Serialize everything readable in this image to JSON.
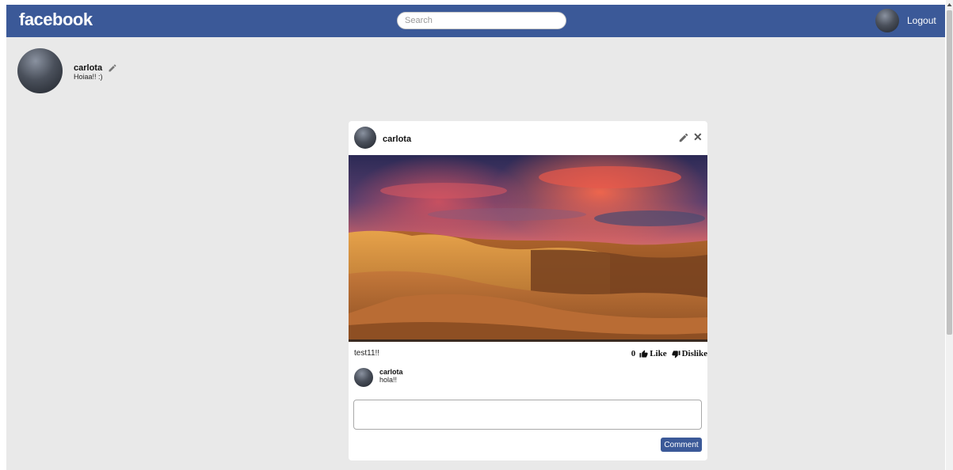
{
  "navbar": {
    "logo": "facebook",
    "search_placeholder": "Search",
    "logout_label": "Logout"
  },
  "profile": {
    "name": "carlota",
    "status": "Hoiaa!! :)"
  },
  "post": {
    "author": "carlota",
    "caption": "test11!!",
    "like_count": "0",
    "like_label": "Like",
    "dislike_label": "Dislike",
    "comments": [
      {
        "author": "carlota",
        "text": "hola!!"
      }
    ],
    "comment_button_label": "Comment"
  },
  "colors": {
    "brand": "#3b5998",
    "background": "#e9e9e9"
  },
  "icons": {
    "edit": "pencil-icon",
    "close": "close-icon",
    "like": "thumbs-up-icon",
    "dislike": "thumbs-down-icon"
  }
}
